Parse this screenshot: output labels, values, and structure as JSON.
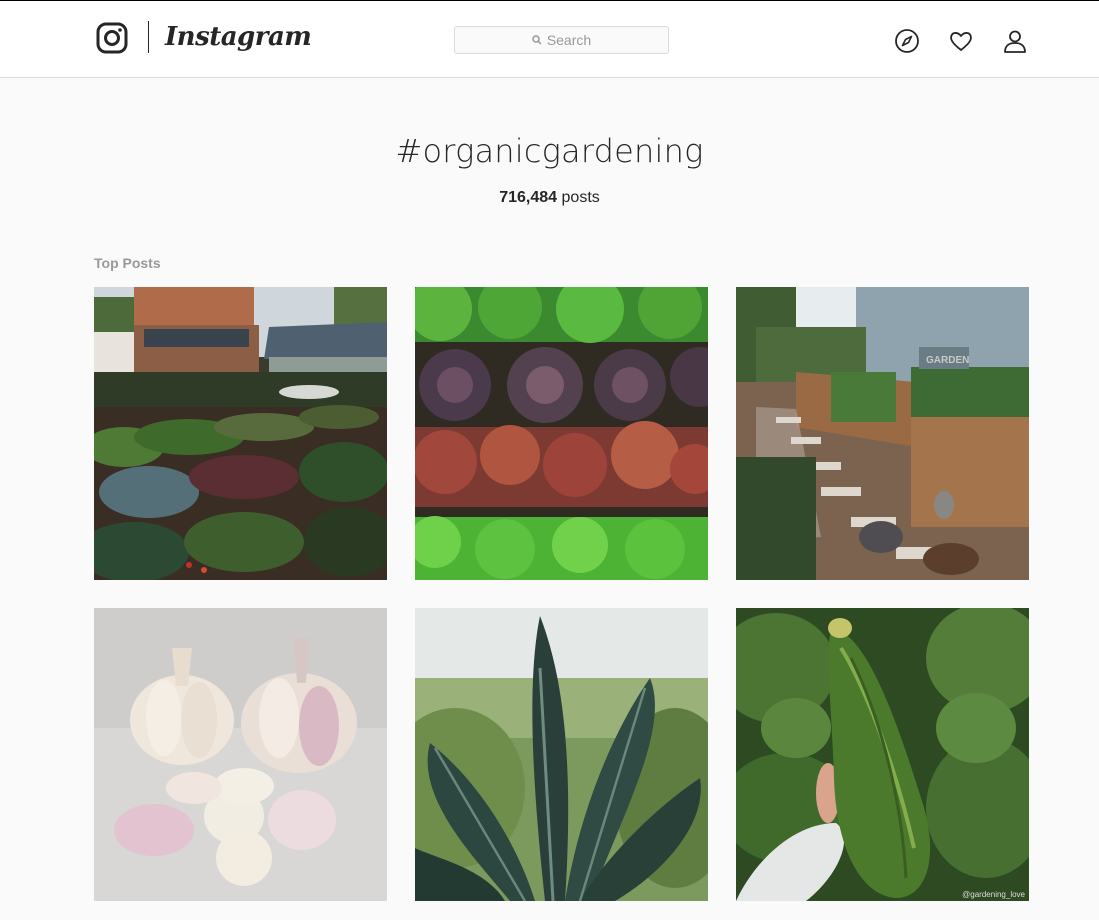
{
  "header": {
    "brand": "Instagram",
    "search": {
      "placeholder": "Search"
    },
    "icons": [
      "explore-icon",
      "heart-icon",
      "profile-icon"
    ]
  },
  "hashtag": {
    "title": "#organicgardening",
    "count": "716,484",
    "count_suffix": " posts"
  },
  "sections": {
    "top_posts_label": "Top Posts"
  },
  "posts": [
    {
      "subject": "garden-beds-greenhouse"
    },
    {
      "subject": "lettuce-rows"
    },
    {
      "subject": "raised-beds-chickens"
    },
    {
      "subject": "garlic-bulbs"
    },
    {
      "subject": "kale-plant"
    },
    {
      "subject": "zucchini-in-hand",
      "watermark": "@gardening_love"
    }
  ],
  "colors": {
    "accent": "#262626",
    "border": "#dbdbdb",
    "muted": "#999999",
    "background": "#fafafa"
  }
}
